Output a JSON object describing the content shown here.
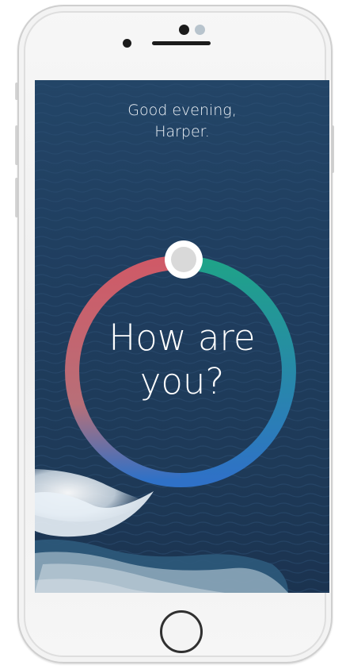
{
  "screen": {
    "greeting_line1": "Good evening,",
    "greeting_line2": "Harper.",
    "prompt_line1": "How are",
    "prompt_line2": "you?"
  },
  "mood_ring": {
    "colors": {
      "red": "#cf5a67",
      "teal": "#1fa289",
      "blue": "#2f71c7",
      "knob_fill": "#d9d9d9",
      "knob_border": "#ffffff"
    }
  },
  "icons": {
    "home_button": "home-button-icon",
    "front_camera": "camera-icon",
    "speaker": "speaker-grille-icon"
  }
}
